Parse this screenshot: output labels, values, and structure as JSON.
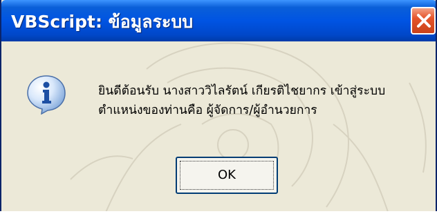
{
  "window": {
    "title": "VBScript: ข้อมูลระบบ",
    "close_icon": "close-icon"
  },
  "message": {
    "icon": "information-icon",
    "line1": "ยินดีต้อนรับ นางสาววิไลรัตน์   เกียรติไชยากร เข้าสู่ระบบ",
    "line2": "ตำแหน่งของท่านคือ ผู้จัดการ/ผู้อำนวยการ"
  },
  "buttons": {
    "ok_label": "OK"
  },
  "colors": {
    "titlebar": "#0054e3",
    "close_button": "#e5542b",
    "dialog_bg": "#ece9d8"
  }
}
